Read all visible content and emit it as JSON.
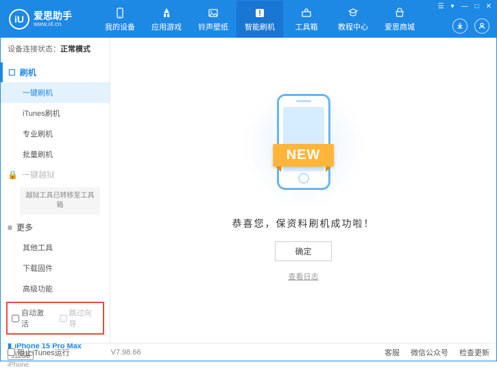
{
  "logo": {
    "glyph": "iU",
    "title": "爱思助手",
    "url": "www.i4.cn"
  },
  "nav": [
    {
      "label": "我的设备"
    },
    {
      "label": "应用游戏"
    },
    {
      "label": "铃声壁纸"
    },
    {
      "label": "智能刷机"
    },
    {
      "label": "工具箱"
    },
    {
      "label": "教程中心"
    },
    {
      "label": "爱思商城"
    }
  ],
  "sidebar": {
    "conn_label": "设备连接状态：",
    "conn_value": "正常模式",
    "section_flash": "刷机",
    "items_flash": [
      "一键刷机",
      "iTunes刷机",
      "专业刷机",
      "批量刷机"
    ],
    "section_jailbreak": "一键越狱",
    "jailbreak_note": "越狱工具已转移至工具箱",
    "section_more": "更多",
    "items_more": [
      "其他工具",
      "下载固件",
      "高级功能"
    ],
    "checkbox_auto_activate": "自动激活",
    "checkbox_skip_guide": "跳过向导",
    "device": {
      "name": "iPhone 15 Pro Max",
      "storage": "512GB",
      "type": "iPhone"
    }
  },
  "main": {
    "ribbon": "NEW",
    "success_text": "恭喜您，保资料刷机成功啦！",
    "ok_button": "确定",
    "log_link": "查看日志"
  },
  "footer": {
    "block_itunes": "阻止iTunes运行",
    "version": "V7.98.66",
    "links": [
      "客服",
      "微信公众号",
      "检查更新"
    ]
  }
}
